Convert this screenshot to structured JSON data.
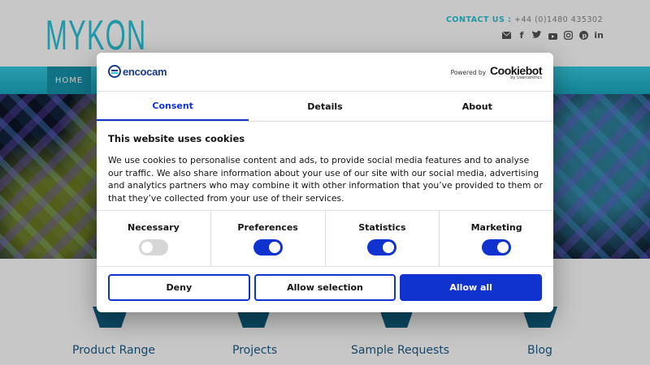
{
  "site": {
    "logo": "MYKON",
    "contact_label": "CONTACT US :",
    "contact_phone": "+44 (0)1480 435302",
    "social_icons": [
      "envelope-icon",
      "facebook-icon",
      "twitter-icon",
      "youtube-icon",
      "instagram-icon",
      "pinterest-icon",
      "linkedin-icon"
    ],
    "nav": {
      "home": "HOME"
    },
    "features": [
      "Product Range",
      "Projects",
      "Sample Requests",
      "Blog"
    ],
    "colors": {
      "accent": "#2bc3d6",
      "nav_active": "#1693ab",
      "tile": "#0f5f80",
      "feature_text": "#1b5b86"
    }
  },
  "cookie_dialog": {
    "brand": "encocam",
    "powered_by": "Powered by",
    "cookiebot_logo": "Cookiebot",
    "cookiebot_sub": "by Usercentrics",
    "tabs": [
      {
        "label": "Consent",
        "active": true
      },
      {
        "label": "Details",
        "active": false
      },
      {
        "label": "About",
        "active": false
      }
    ],
    "heading": "This website uses cookies",
    "text": "We use cookies to personalise content and ads, to provide social media features and to analyse our traffic. We also share information about your use of our site with our social media, advertising and analytics partners who may combine it with other information that you’ve provided to them or that they’ve collected from your use of their services.",
    "toggles": [
      {
        "label": "Necessary",
        "on": true,
        "disabled": true
      },
      {
        "label": "Preferences",
        "on": true,
        "disabled": false
      },
      {
        "label": "Statistics",
        "on": true,
        "disabled": false
      },
      {
        "label": "Marketing",
        "on": true,
        "disabled": false
      }
    ],
    "buttons": {
      "deny": "Deny",
      "allow_selection": "Allow selection",
      "allow_all": "Allow all"
    },
    "colors": {
      "primary": "#1032cf",
      "toggle_disabled": "#d6d6d6"
    }
  }
}
